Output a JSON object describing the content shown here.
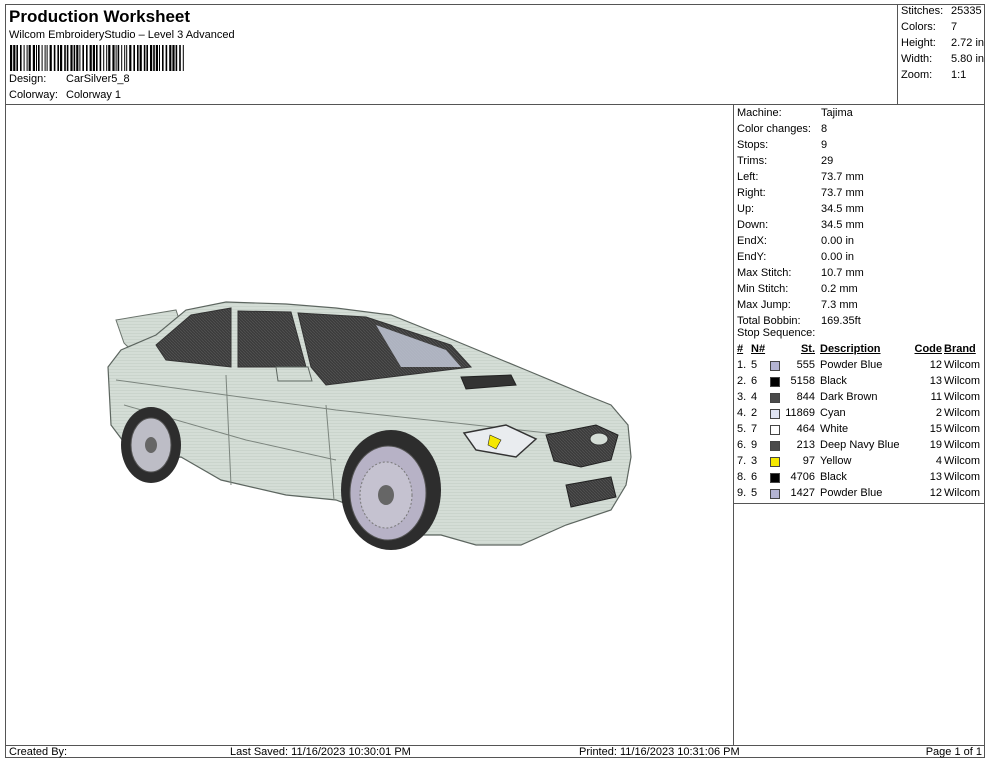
{
  "header": {
    "title": "Production Worksheet",
    "subtitle": "Wilcom EmbroideryStudio – Level 3 Advanced",
    "design_label": "Design:",
    "design_value": "CarSilver5_8",
    "colorway_label": "Colorway:",
    "colorway_value": "Colorway 1"
  },
  "stats": [
    {
      "label": "Stitches:",
      "value": "25335"
    },
    {
      "label": "Colors:",
      "value": "7"
    },
    {
      "label": "Height:",
      "value": "2.72 in"
    },
    {
      "label": "Width:",
      "value": "5.80 in"
    },
    {
      "label": "Zoom:",
      "value": "1:1"
    }
  ],
  "machine_info": [
    {
      "label": "Machine:",
      "value": "Tajima"
    },
    {
      "label": "Color changes:",
      "value": "8"
    },
    {
      "label": "Stops:",
      "value": "9"
    },
    {
      "label": "Trims:",
      "value": "29"
    },
    {
      "label": "Left:",
      "value": "73.7 mm"
    },
    {
      "label": "Right:",
      "value": "73.7 mm"
    },
    {
      "label": "Up:",
      "value": "34.5 mm"
    },
    {
      "label": "Down:",
      "value": "34.5 mm"
    },
    {
      "label": "EndX:",
      "value": "0.00 in"
    },
    {
      "label": "EndY:",
      "value": "0.00 in"
    },
    {
      "label": "Max Stitch:",
      "value": "10.7 mm"
    },
    {
      "label": "Min Stitch:",
      "value": "0.2 mm"
    },
    {
      "label": "Max Jump:",
      "value": "7.3 mm"
    },
    {
      "label": "Total Bobbin:",
      "value": "169.35ft"
    }
  ],
  "stop_sequence": {
    "title": "Stop Sequence:",
    "headers": {
      "num": "#",
      "n": "N#",
      "st": "St.",
      "desc": "Description",
      "code": "Code",
      "brand": "Brand"
    },
    "rows": [
      {
        "num": "1.",
        "n": "5",
        "color": "#b4b4d2",
        "st": "555",
        "desc": "Powder Blue",
        "code": "12",
        "brand": "Wilcom"
      },
      {
        "num": "2.",
        "n": "6",
        "color": "#000000",
        "st": "5158",
        "desc": "Black",
        "code": "13",
        "brand": "Wilcom"
      },
      {
        "num": "3.",
        "n": "4",
        "color": "#4a4a4a",
        "st": "844",
        "desc": "Dark Brown",
        "code": "11",
        "brand": "Wilcom"
      },
      {
        "num": "4.",
        "n": "2",
        "color": "#dfe3f2",
        "st": "11869",
        "desc": "Cyan",
        "code": "2",
        "brand": "Wilcom"
      },
      {
        "num": "5.",
        "n": "7",
        "color": "#ffffff",
        "st": "464",
        "desc": "White",
        "code": "15",
        "brand": "Wilcom"
      },
      {
        "num": "6.",
        "n": "9",
        "color": "#4b4b4b",
        "st": "213",
        "desc": "Deep Navy Blue",
        "code": "19",
        "brand": "Wilcom"
      },
      {
        "num": "7.",
        "n": "3",
        "color": "#f5e800",
        "st": "97",
        "desc": "Yellow",
        "code": "4",
        "brand": "Wilcom"
      },
      {
        "num": "8.",
        "n": "6",
        "color": "#000000",
        "st": "4706",
        "desc": "Black",
        "code": "13",
        "brand": "Wilcom"
      },
      {
        "num": "9.",
        "n": "5",
        "color": "#b4b4d2",
        "st": "1427",
        "desc": "Powder Blue",
        "code": "12",
        "brand": "Wilcom"
      }
    ]
  },
  "footer": {
    "created_by": "Created By:",
    "last_saved": "Last Saved: 11/16/2023 10:30:01 PM",
    "printed": "Printed: 11/16/2023 10:31:06 PM",
    "page": "Page 1 of 1"
  }
}
